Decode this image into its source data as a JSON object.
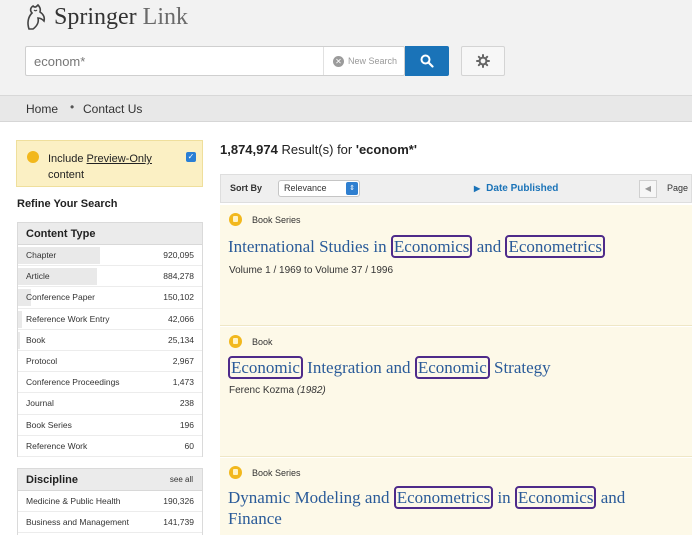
{
  "header": {
    "brand_name": "Springer",
    "brand_suffix": "Link",
    "search": {
      "value": "econom*",
      "new_search_label": "New Search"
    }
  },
  "nav": {
    "items": [
      "Home",
      "Contact Us"
    ]
  },
  "sidebar": {
    "preview": {
      "label_prefix": "Include ",
      "label_link": "Preview-Only",
      "label_suffix": "content",
      "checked": true
    },
    "refine_title": "Refine Your Search",
    "content_type": {
      "title": "Content Type",
      "items": [
        {
          "label": "Chapter",
          "count": "920,095",
          "fraction": 1.0
        },
        {
          "label": "Article",
          "count": "884,278",
          "fraction": 0.96
        },
        {
          "label": "Conference Paper",
          "count": "150,102",
          "fraction": 0.16
        },
        {
          "label": "Reference Work Entry",
          "count": "42,066",
          "fraction": 0.05
        },
        {
          "label": "Book",
          "count": "25,134",
          "fraction": 0.03
        },
        {
          "label": "Protocol",
          "count": "2,967",
          "fraction": 0.0
        },
        {
          "label": "Conference Proceedings",
          "count": "1,473",
          "fraction": 0.0
        },
        {
          "label": "Journal",
          "count": "238",
          "fraction": 0.0
        },
        {
          "label": "Book Series",
          "count": "196",
          "fraction": 0.0
        },
        {
          "label": "Reference Work",
          "count": "60",
          "fraction": 0.0
        }
      ]
    },
    "discipline": {
      "title": "Discipline",
      "see_all": "see all",
      "items": [
        {
          "label": "Medicine & Public Health",
          "count": "190,326"
        },
        {
          "label": "Business and Management",
          "count": "141,739"
        }
      ]
    }
  },
  "main": {
    "results_count": "1,874,974",
    "results_text": " Result(s) for ",
    "query_display": "'econom*'",
    "sortbar": {
      "sort_by_label": "Sort By",
      "sort_value": "Relevance",
      "date_published": "Date Published",
      "page_label": "Page"
    },
    "results": [
      {
        "type": "Book Series",
        "title_parts": [
          "International Studies in ",
          "Economics",
          " and ",
          "Econometrics"
        ],
        "subtitle": "Volume 1 / 1969 to Volume 37 / 1996"
      },
      {
        "type": "Book",
        "title_parts": [
          "Economic",
          " Integration and ",
          "Economic",
          " Strategy"
        ],
        "author": "Ferenc Kozma",
        "year": "(1982)"
      },
      {
        "type": "Book Series",
        "title_parts": [
          "Dynamic Modeling and ",
          "Econometrics",
          " in ",
          "Economics",
          " and"
        ],
        "title_line2": "Finance"
      }
    ]
  },
  "colors": {
    "accent": "#1a73b8",
    "highlight_border": "#4e2b8a",
    "result_bg": "#fdf9e8",
    "preview_bg": "#fbf0c4",
    "type_icon": "#f2b81d"
  }
}
